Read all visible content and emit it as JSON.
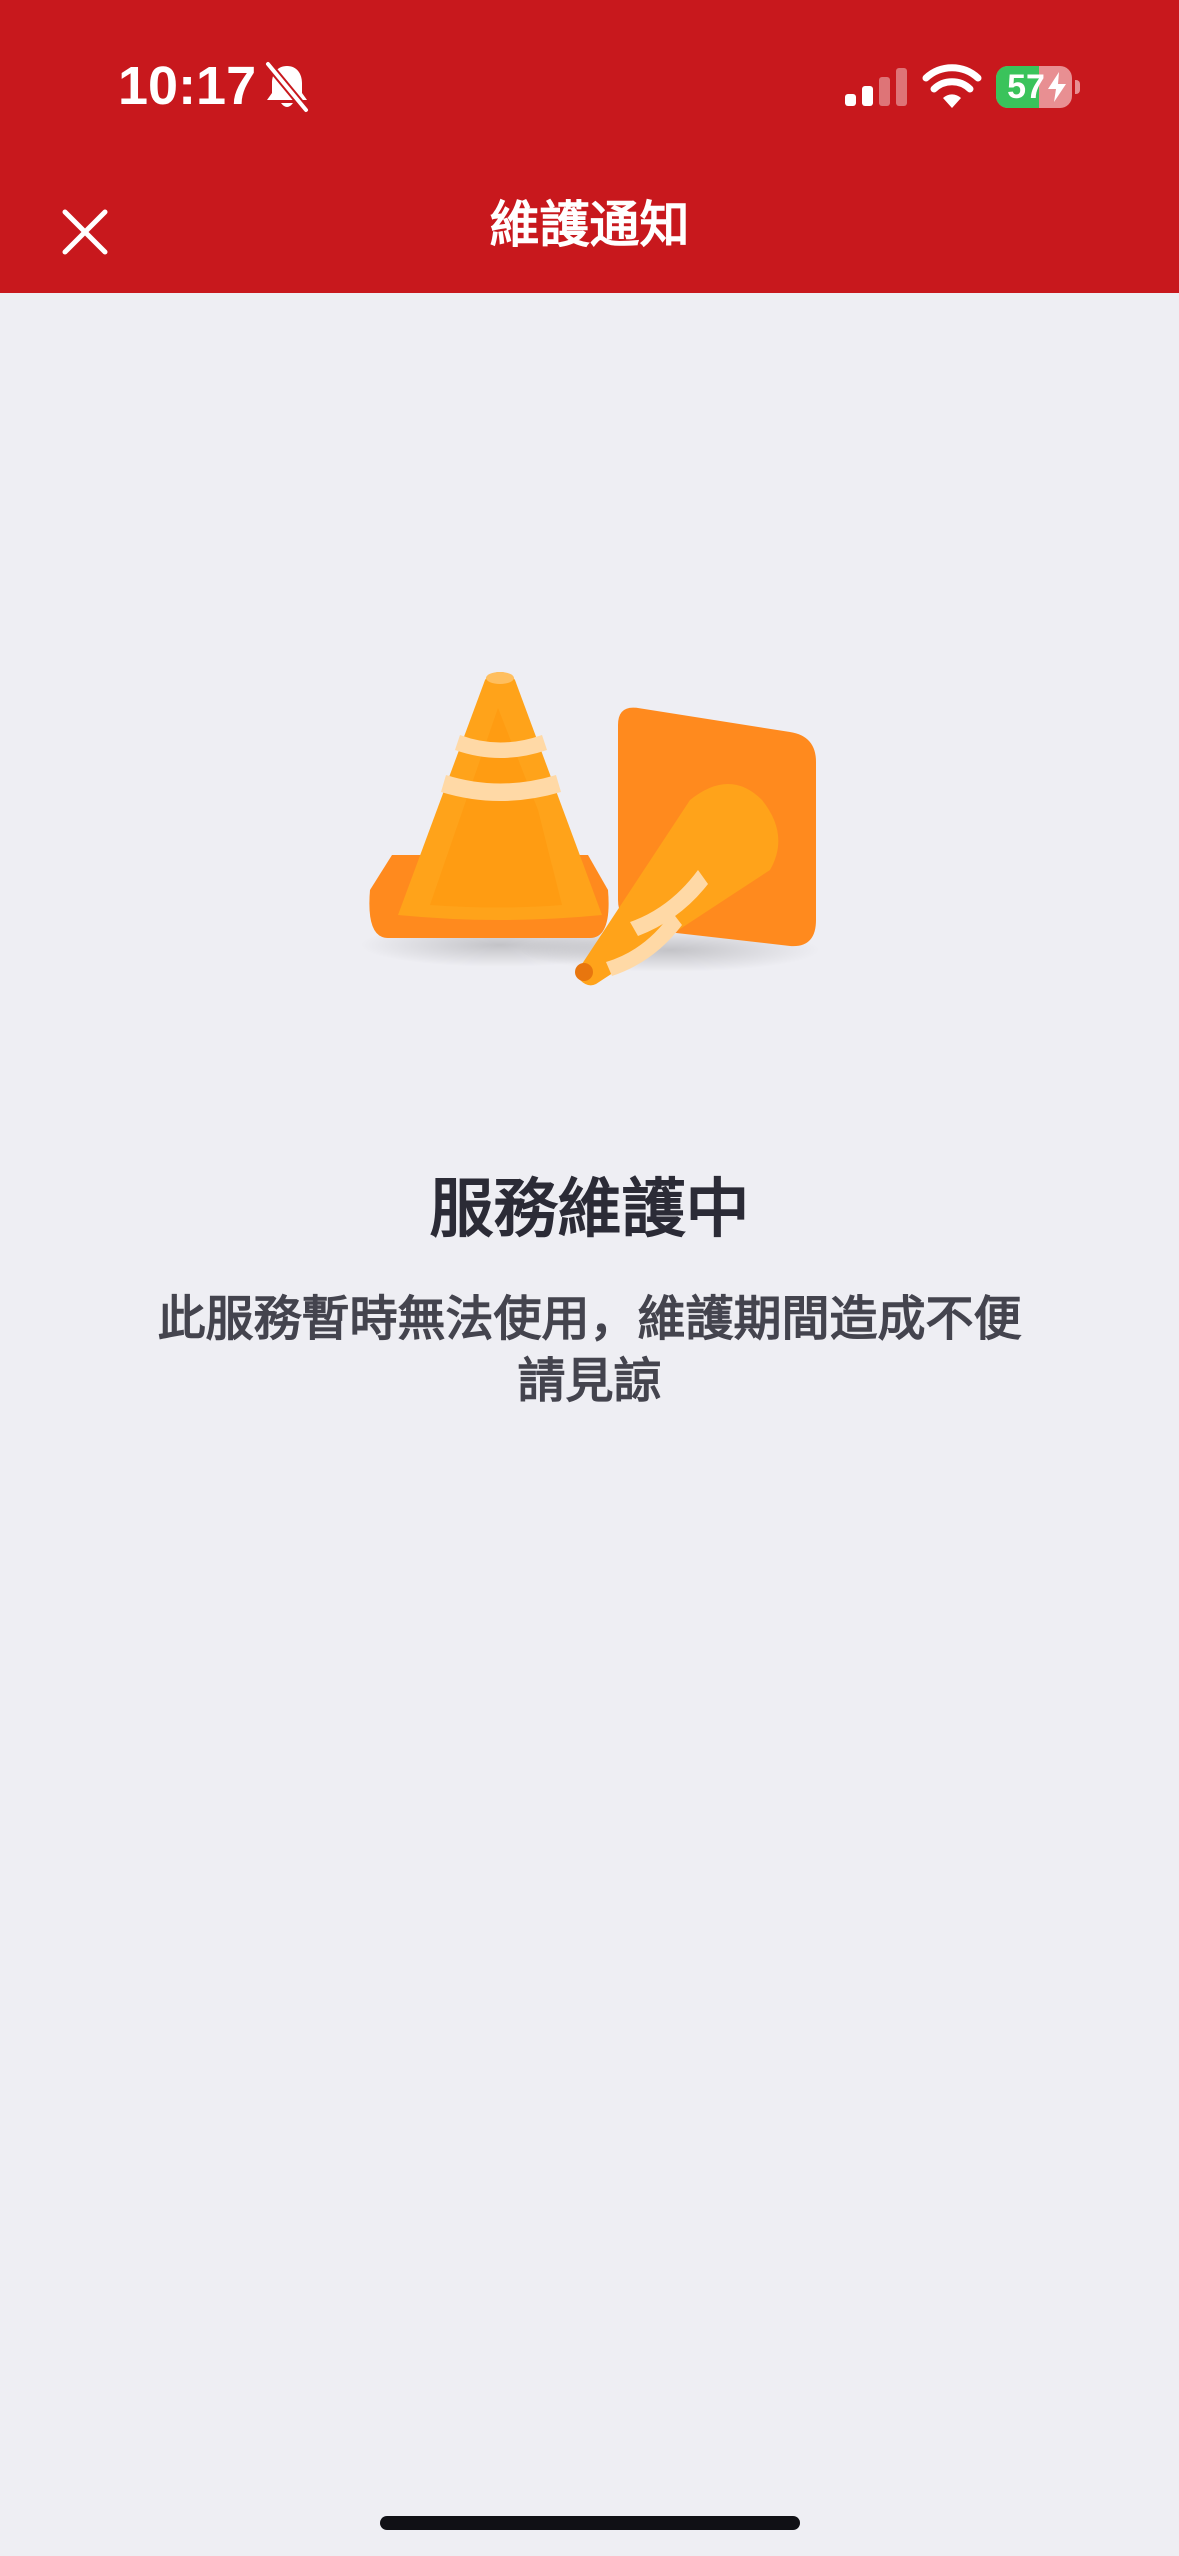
{
  "status_bar": {
    "time": "10:17",
    "battery_level": "57",
    "silent_mode": true
  },
  "nav": {
    "title": "維護通知",
    "close_icon": "close-icon"
  },
  "main": {
    "illustration": "traffic-cones-icon",
    "title": "服務維護中",
    "description": "此服務暫時無法使用，維護期間造成不便請見諒"
  },
  "colors": {
    "header_red": "#c8181d",
    "background": "#eeeef3",
    "cone_orange": "#ff9c12",
    "battery_green": "#3ac35b"
  }
}
